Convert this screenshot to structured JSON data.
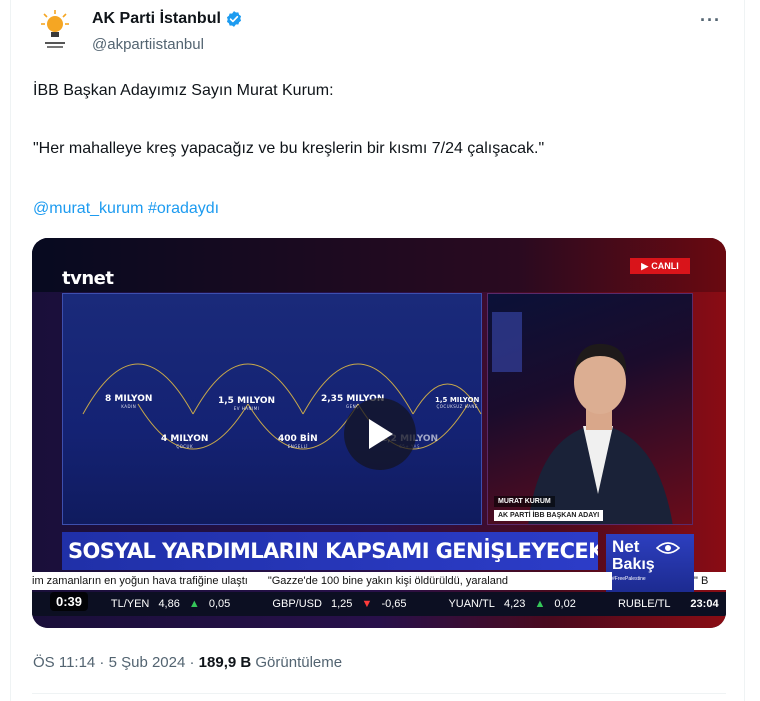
{
  "account": {
    "display_name": "AK Parti İstanbul",
    "handle": "@akpartiistanbul",
    "verified": true,
    "avatar_icon": "ak-parti-lightbulb-logo"
  },
  "more_label": "···",
  "tweet": {
    "line1": "İBB Başkan Adayımız Sayın Murat Kurum:",
    "line2": "\"Her mahalleye kreş yapacağız ve bu kreşlerin bir kısmı 7/24 çalışacak.\"",
    "mention": "@murat_kurum",
    "hashtag": "#oradaydı"
  },
  "video": {
    "channel": "tvnet",
    "live_badge": "CANLI",
    "stats": [
      {
        "value": "8 MILYON",
        "label": "KADIN"
      },
      {
        "value": "4 MILYON",
        "label": "ÇOCUK"
      },
      {
        "value": "1,5 MILYON",
        "label": "EV HANIMI"
      },
      {
        "value": "400 BİN",
        "label": "ENGELLİ"
      },
      {
        "value": "2,35 MILYON",
        "label": "GENÇ"
      },
      {
        "value": "1,2 MILYON",
        "label": "65+ YAŞ"
      },
      {
        "value": "1,5 MILYON",
        "label": "ÇOCUKSUZ HANE"
      }
    ],
    "lower_third_name": "MURAT KURUM",
    "lower_third_title": "AK PARTİ İBB BAŞKAN ADAYI",
    "headline": "SOSYAL YARDIMLARIN KAPSAMI GENİŞLEYECEK Mİ?",
    "program_line1": "Net",
    "program_line2": "Bakış",
    "program_tag": "#FreePalestine",
    "ticker_news_1": "im zamanların en yoğun hava trafiğine ulaştı",
    "ticker_news_2": "\"Gazze'de 100 bine yakın kişi öldürüldü, yaraland",
    "ticker_news_end": "\" B",
    "markets": [
      {
        "label": "TL/YEN",
        "value": "4,86",
        "dir": "up",
        "change": "0,05"
      },
      {
        "label": "GBP/USD",
        "value": "1,25",
        "dir": "down",
        "change": "-0,65"
      },
      {
        "label": "YUAN/TL",
        "value": "4,23",
        "dir": "up",
        "change": "0,02"
      },
      {
        "label": "RUBLE/TL",
        "value": "",
        "dir": "",
        "change": ""
      }
    ],
    "clock": "23:04",
    "duration": "0:39",
    "play_icon": "play-icon"
  },
  "meta": {
    "time": "ÖS 11:14 · 5 Şub 2024 · ",
    "views": "189,9 B",
    "views_label": " Görüntüleme"
  }
}
